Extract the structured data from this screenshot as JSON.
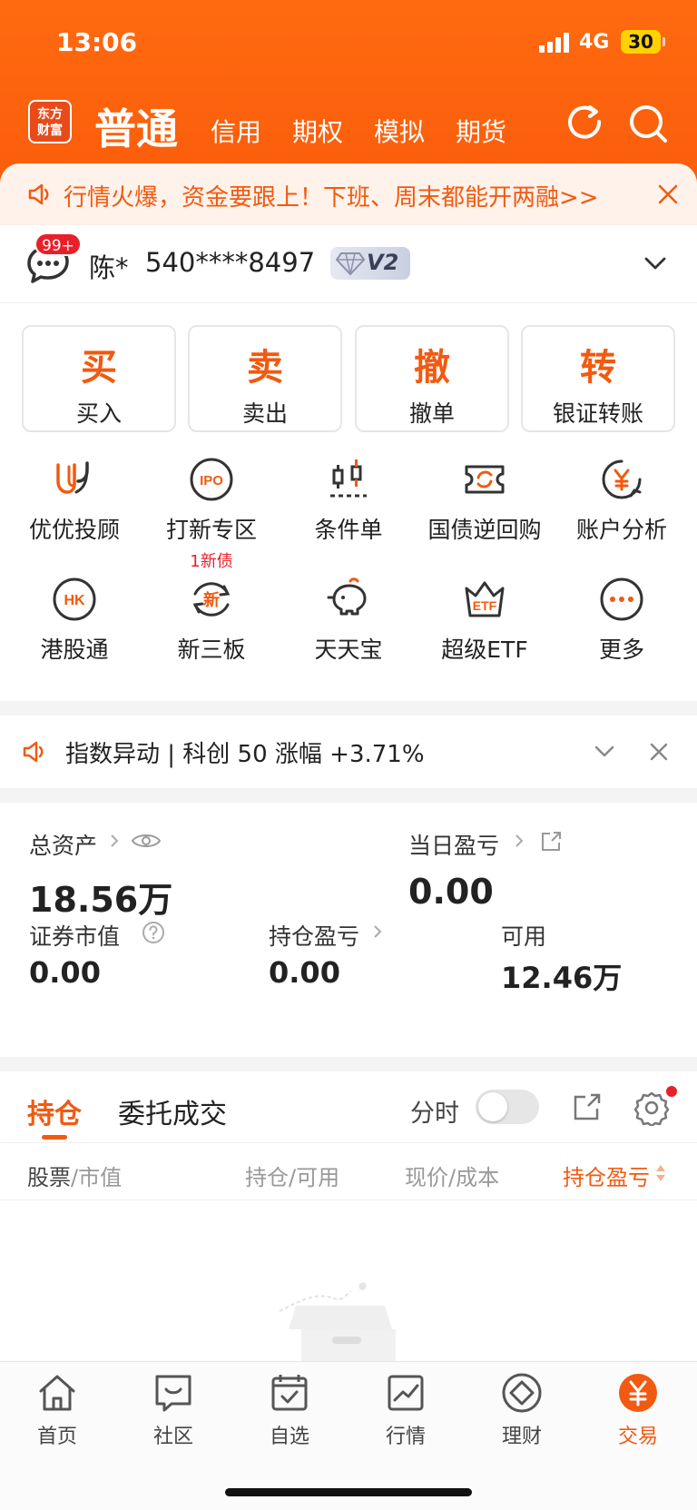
{
  "status_bar": {
    "time": "13:06",
    "network": "4G",
    "battery": "30"
  },
  "header": {
    "logo_text": "东方\n财富",
    "active_tab": "普通",
    "tabs": [
      "信用",
      "期权",
      "模拟",
      "期货"
    ]
  },
  "promo": {
    "text": "行情火爆，资金要跟上！下班、周末都能开两融>>"
  },
  "account": {
    "message_badge": "99+",
    "name": "陈*",
    "number": "540****8497",
    "level": "V2"
  },
  "trade_buttons": [
    {
      "big": "买",
      "label": "买入"
    },
    {
      "big": "卖",
      "label": "卖出"
    },
    {
      "big": "撤",
      "label": "撤单"
    },
    {
      "big": "转",
      "label": "银证转账"
    }
  ],
  "grid_row1": [
    {
      "label": "优优投顾",
      "icon": "uu-advisor-icon"
    },
    {
      "label": "打新专区",
      "sub": "1新债",
      "icon": "ipo-icon"
    },
    {
      "label": "条件单",
      "icon": "candlestick-icon"
    },
    {
      "label": "国债逆回购",
      "icon": "ticket-refresh-icon"
    },
    {
      "label": "账户分析",
      "icon": "yen-chart-icon"
    }
  ],
  "grid_row2": [
    {
      "label": "港股通",
      "icon": "hk-icon"
    },
    {
      "label": "新三板",
      "icon": "new-board-icon"
    },
    {
      "label": "天天宝",
      "icon": "piggy-bank-icon"
    },
    {
      "label": "超级ETF",
      "icon": "etf-crown-icon"
    },
    {
      "label": "更多",
      "icon": "more-icon"
    }
  ],
  "notice": {
    "text": "指数异动 | 科创 50 涨幅 +3.71%"
  },
  "assets": {
    "total_label": "总资产",
    "total_value": "18.56万",
    "daily_pl_label": "当日盈亏",
    "daily_pl_value": "0.00",
    "market_value_label": "证券市值",
    "market_value": "0.00",
    "position_pl_label": "持仓盈亏",
    "position_pl_value": "0.00",
    "available_label": "可用",
    "available_value": "12.46万"
  },
  "holdings": {
    "tab_active": "持仓",
    "tab_other": "委托成交",
    "timeshare_label": "分时",
    "columns": [
      {
        "main": "股票",
        "sub": "/市值"
      },
      {
        "main": "持仓",
        "sub": "/可用"
      },
      {
        "main": "现价",
        "sub": "/成本"
      },
      {
        "main": "持仓盈亏",
        "sub": ""
      }
    ]
  },
  "bottom_nav": [
    {
      "label": "首页",
      "icon": "home-icon"
    },
    {
      "label": "社区",
      "icon": "chat-icon"
    },
    {
      "label": "自选",
      "icon": "watchlist-icon"
    },
    {
      "label": "行情",
      "icon": "market-chart-icon"
    },
    {
      "label": "理财",
      "icon": "diamond-icon"
    },
    {
      "label": "交易",
      "icon": "yuan-icon",
      "active": true
    }
  ],
  "colors": {
    "brand": "#fa5a0a",
    "accent_text": "#f15a10",
    "badge": "#e8202a"
  }
}
